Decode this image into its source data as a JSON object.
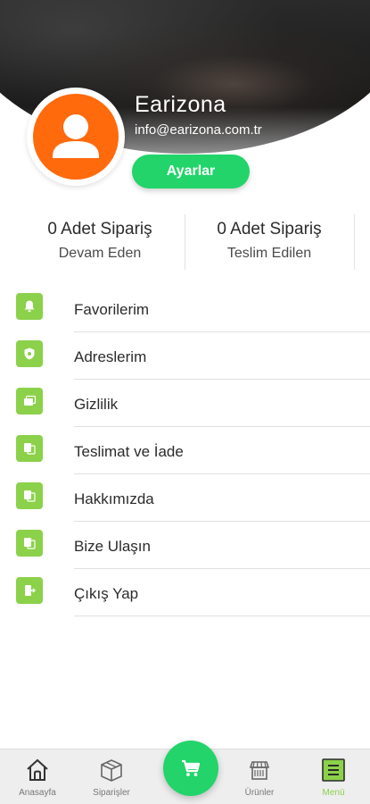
{
  "profile": {
    "name": "Earizona",
    "email": "info@earizona.com.tr",
    "settings_label": "Ayarlar"
  },
  "stats": [
    {
      "count": "0 Adet Sipariş",
      "label": "Devam Eden"
    },
    {
      "count": "0 Adet Sipariş",
      "label": "Teslim Edilen"
    }
  ],
  "menu": {
    "items": [
      {
        "label": "Favorilerim",
        "icon": "bell-icon"
      },
      {
        "label": "Adreslerim",
        "icon": "shield-icon"
      },
      {
        "label": "Gizlilik",
        "icon": "cards-icon"
      },
      {
        "label": "Teslimat ve İade",
        "icon": "document-icon"
      },
      {
        "label": "Hakkımızda",
        "icon": "document-icon"
      },
      {
        "label": "Bize Ulaşın",
        "icon": "document-icon"
      },
      {
        "label": "Çıkış Yap",
        "icon": "logout-icon"
      }
    ]
  },
  "bottom_nav": {
    "items": [
      {
        "label": "Anasayfa",
        "icon": "home-icon"
      },
      {
        "label": "Siparişler",
        "icon": "box-icon"
      },
      {
        "label": "Ürünler",
        "icon": "shop-icon"
      },
      {
        "label": "Menü",
        "icon": "menu-icon",
        "active": true
      }
    ],
    "cart_icon": "cart-icon"
  },
  "colors": {
    "accent_green": "#22d46a",
    "icon_green": "#8bd14a",
    "avatar_orange": "#ff6a0d"
  }
}
